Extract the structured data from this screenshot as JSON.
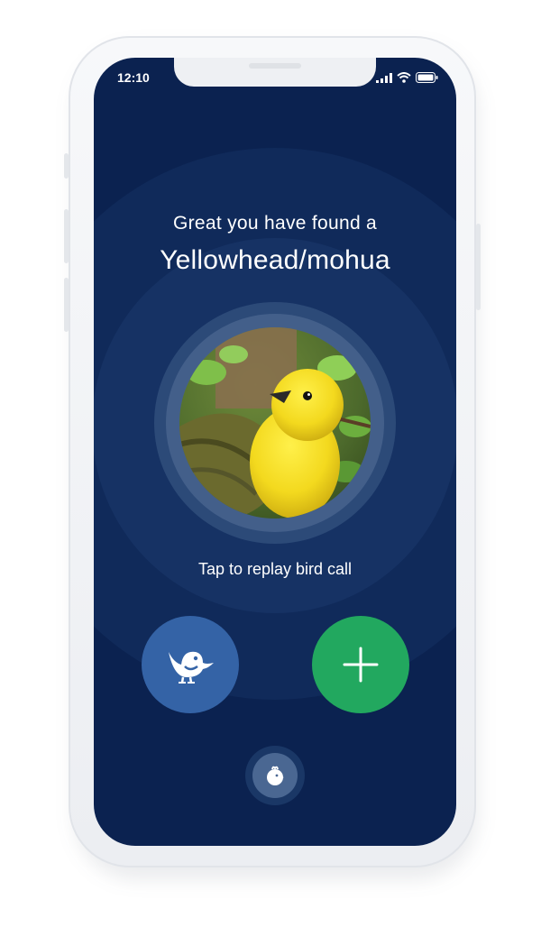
{
  "status_bar": {
    "time": "12:10"
  },
  "main": {
    "heading_small": "Great you have found a",
    "bird_name": "Yellowhead/mohua",
    "replay_label": "Tap to replay bird call"
  },
  "icons": {
    "bird_button": "bird-icon",
    "add_button": "plus-icon",
    "bottom_button": "chick-icon"
  },
  "colors": {
    "background": "#0b2250",
    "bird_button": "#3463a6",
    "add_button": "#22a85f",
    "text": "#ffffff"
  }
}
